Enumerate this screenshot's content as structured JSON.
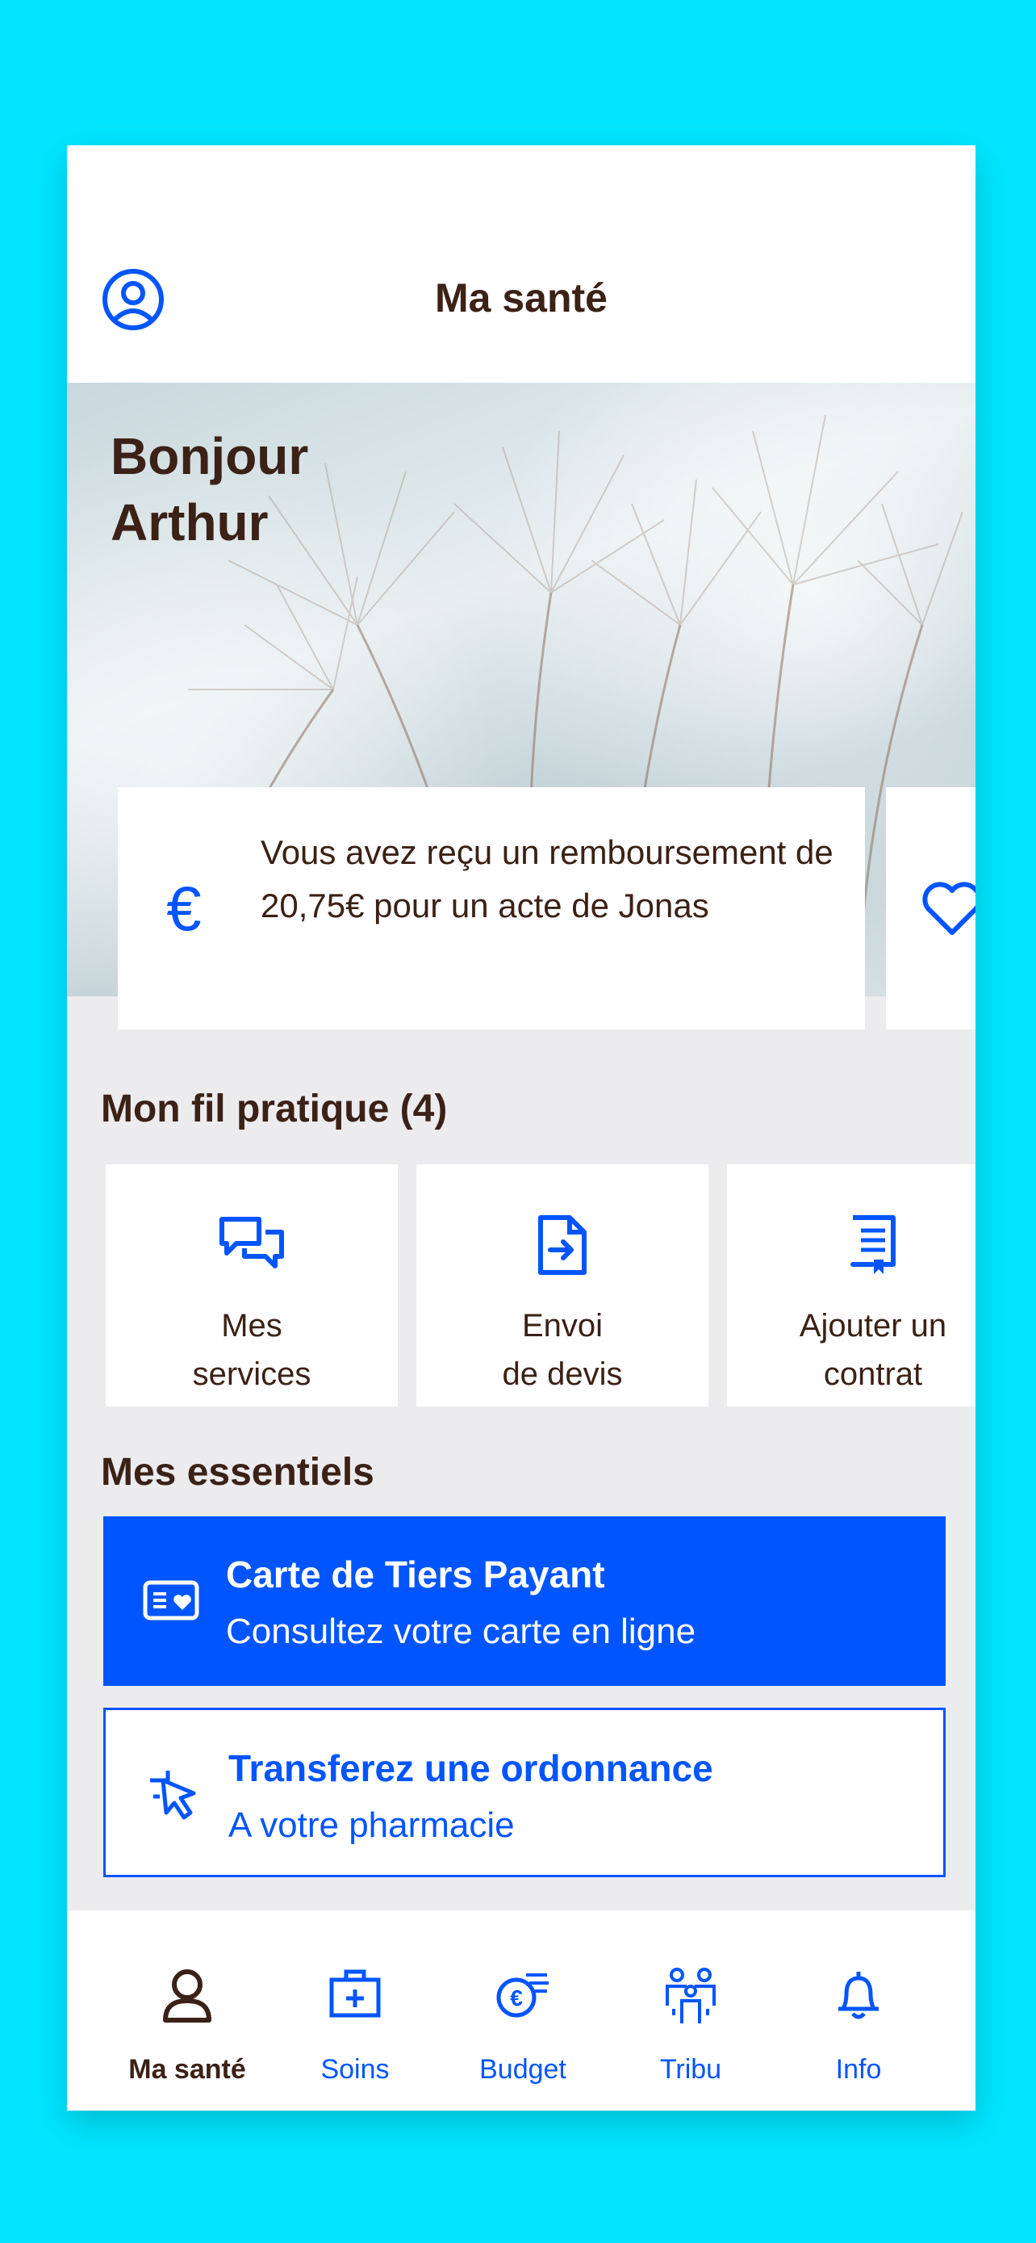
{
  "header": {
    "title": "Ma santé",
    "profile_icon": "user-circle-icon"
  },
  "hero": {
    "greeting_line1": "Bonjour",
    "greeting_line2": "Arthur"
  },
  "notification": {
    "icon": "euro-icon",
    "text": "Vous avez reçu un remboursement de 20,75€ pour un acte de Jonas",
    "next_icon": "heart-icon"
  },
  "fil_pratique": {
    "title": "Mon fil pratique (4)",
    "tiles": [
      {
        "label": "Mes\nservices",
        "icon": "chat-bubbles-icon"
      },
      {
        "label": "Envoi\nde devis",
        "icon": "document-send-icon"
      },
      {
        "label": "Ajouter un\ncontrat",
        "icon": "contract-icon"
      }
    ]
  },
  "essentiels": {
    "title": "Mes essentiels",
    "items": [
      {
        "title": "Carte de Tiers Payant",
        "subtitle": "Consultez votre carte en ligne",
        "icon": "card-heart-icon"
      },
      {
        "title": "Transferez une ordonnance",
        "subtitle": "A votre pharmacie",
        "icon": "cursor-click-icon"
      }
    ]
  },
  "tabbar": {
    "items": [
      {
        "label": "Ma santé",
        "icon": "person-icon",
        "active": true
      },
      {
        "label": "Soins",
        "icon": "medical-kit-icon"
      },
      {
        "label": "Budget",
        "icon": "euro-coins-icon"
      },
      {
        "label": "Tribu",
        "icon": "family-icon"
      },
      {
        "label": "Info",
        "icon": "bell-icon"
      }
    ]
  },
  "colors": {
    "accent": "#0055ff",
    "text": "#3b2116",
    "background": "#00e5ff"
  }
}
